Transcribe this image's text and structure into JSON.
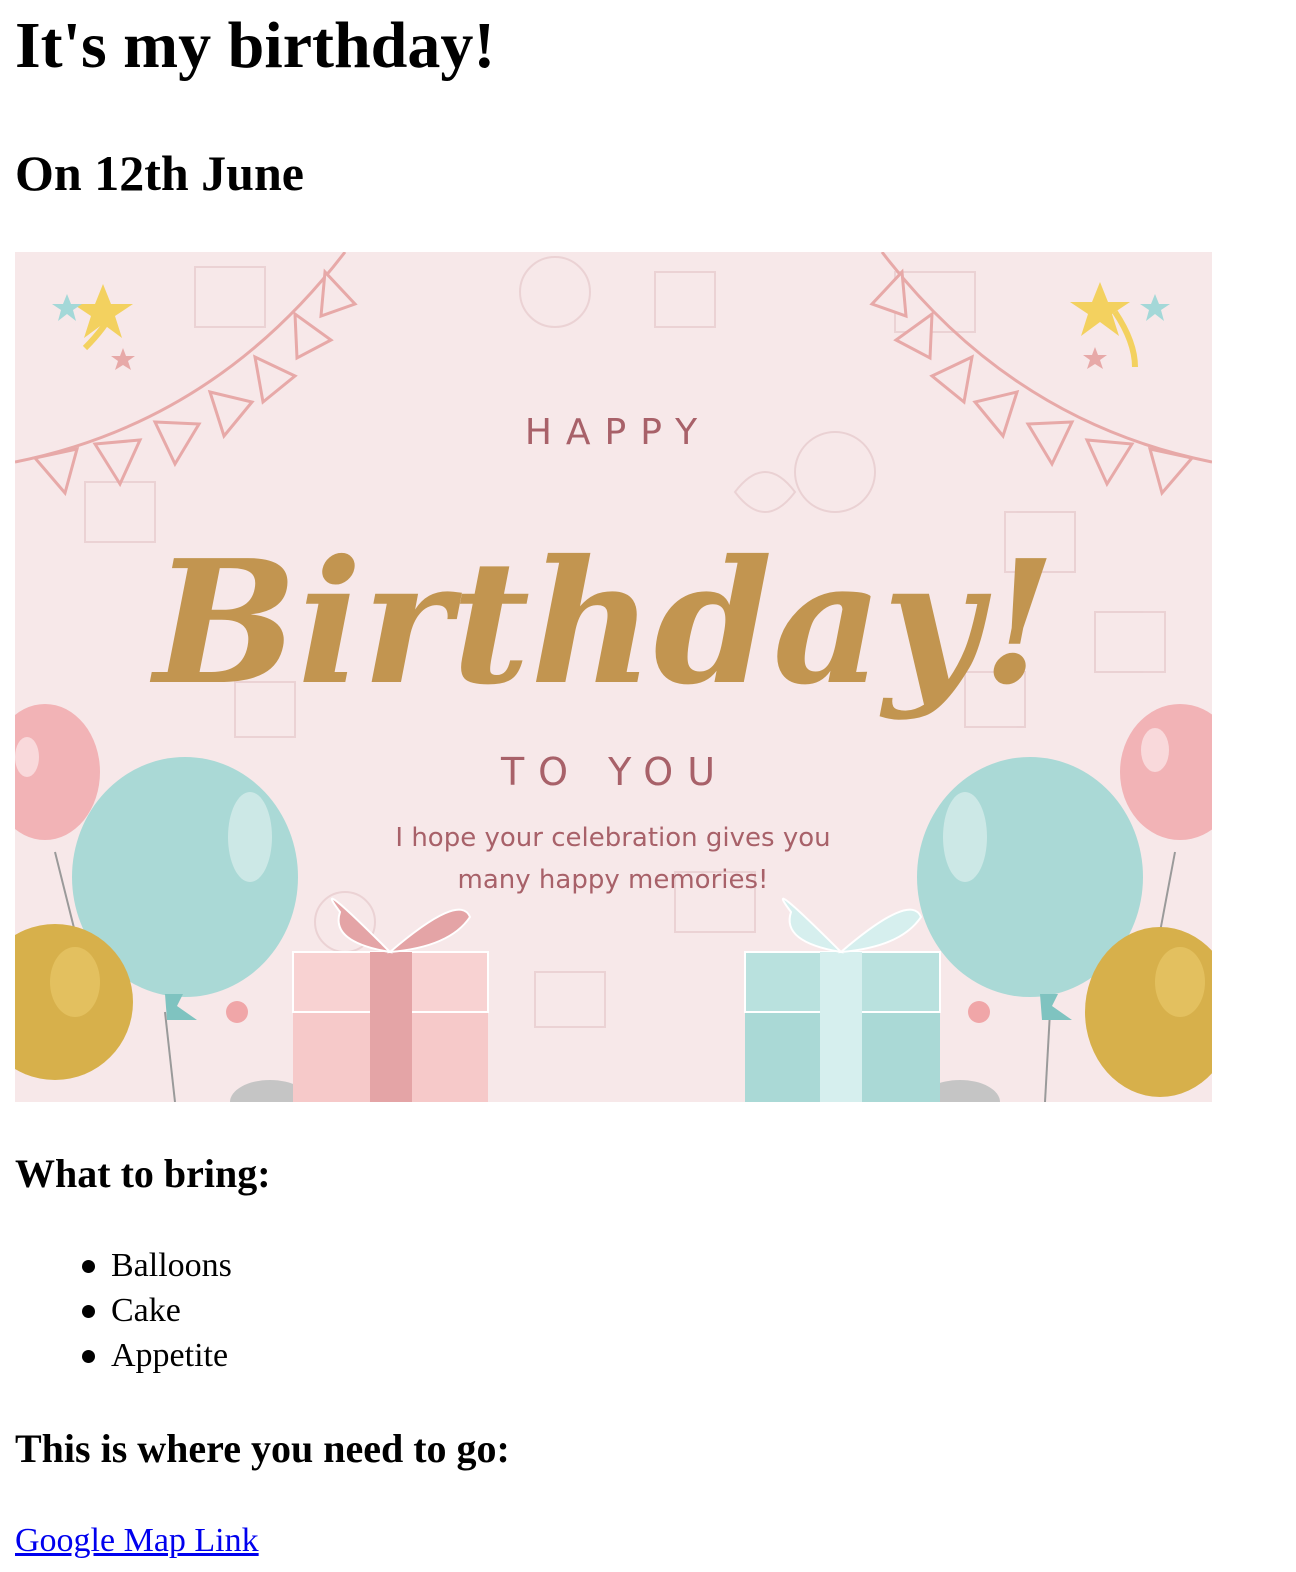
{
  "page": {
    "title": "It's my birthday!",
    "date": "On 12th June"
  },
  "card": {
    "line1": "HAPPY",
    "line2": "Birthday!",
    "line3": "TO YOU",
    "message_line1": "I hope your celebration gives you",
    "message_line2": "many happy memories!",
    "colors": {
      "background": "#f7e8e9",
      "gold": "#c29550",
      "rose_text": "#a86169",
      "teal": "#aad9d6",
      "pink": "#f2b3b6",
      "mustard": "#d7b04b",
      "bunting": "#e7a9a8"
    }
  },
  "bring": {
    "heading": "What to bring:",
    "items": [
      "Balloons",
      "Cake",
      "Appetite"
    ]
  },
  "location": {
    "heading": "This is where you need to go:",
    "link_label": "Google Map Link"
  }
}
